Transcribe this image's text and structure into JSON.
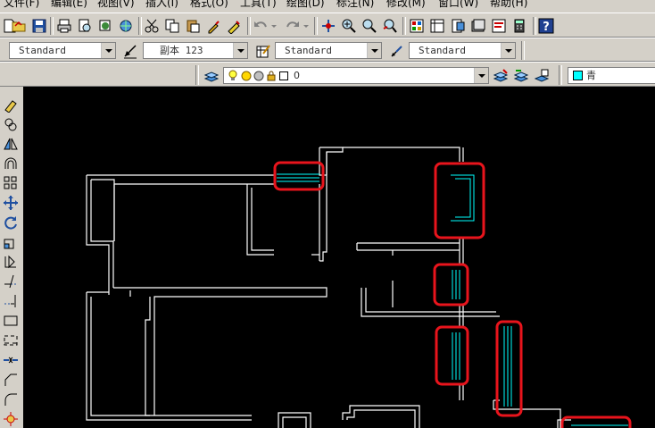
{
  "menu": [
    {
      "id": "file",
      "label": "文件(F)"
    },
    {
      "id": "edit",
      "label": "编辑(E)"
    },
    {
      "id": "view",
      "label": "视图(V)"
    },
    {
      "id": "insert",
      "label": "插入(I)"
    },
    {
      "id": "format",
      "label": "格式(O)"
    },
    {
      "id": "tools",
      "label": "工具(T)"
    },
    {
      "id": "draw",
      "label": "绘图(D)"
    },
    {
      "id": "dimension",
      "label": "标注(N)"
    },
    {
      "id": "modify",
      "label": "修改(M)"
    },
    {
      "id": "window",
      "label": "窗口(W)"
    },
    {
      "id": "help",
      "label": "帮助(H)"
    }
  ],
  "styles_toolbar": {
    "text_style": "Standard",
    "dim_style": "副本 123",
    "table_style": "Standard",
    "multileader_style": "Standard"
  },
  "layers_toolbar": {
    "current_layer": "0",
    "current_color": "青",
    "color_swatch": "#00ffff"
  },
  "colors": {
    "walls": "#ffffff",
    "windows": "#00ffff",
    "highlight": "#e8141c",
    "canvas": "#000000"
  }
}
